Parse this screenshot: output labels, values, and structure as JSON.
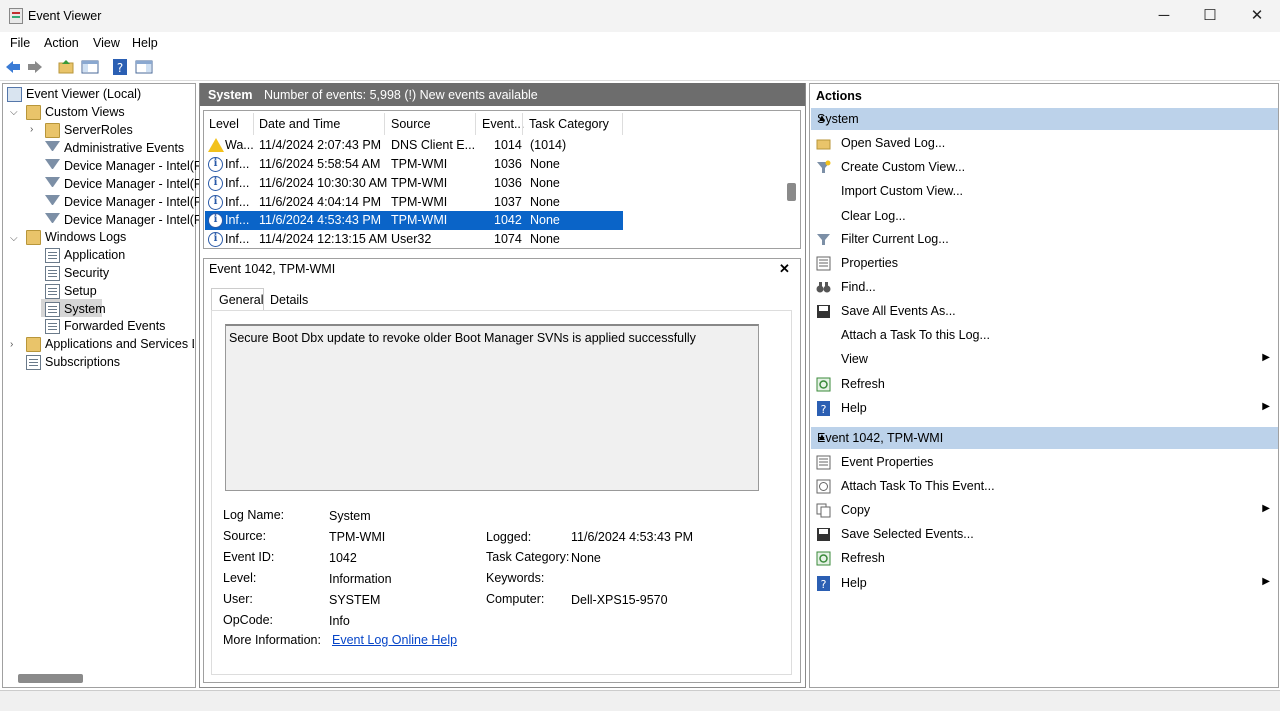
{
  "window": {
    "title": "Event Viewer",
    "minimize": "─",
    "maximize": "☐",
    "close": "✕"
  },
  "menu": [
    "File",
    "Action",
    "View",
    "Help"
  ],
  "tree": {
    "root": "Event Viewer (Local)",
    "custom_views": "Custom Views",
    "server_roles": "ServerRoles",
    "admin_events": "Administrative Events",
    "dm1": "Device Manager - Intel(R)",
    "dm2": "Device Manager - Intel(R)",
    "dm3": "Device Manager - Intel(R)",
    "dm4": "Device Manager - Intel(R)",
    "windows_logs": "Windows Logs",
    "application": "Application",
    "security": "Security",
    "setup": "Setup",
    "system": "System",
    "forwarded": "Forwarded Events",
    "apps_services": "Applications and Services Log",
    "subscriptions": "Subscriptions"
  },
  "log_header": {
    "name": "System",
    "summary": "Number of events: 5,998 (!) New events available"
  },
  "columns": {
    "level": "Level",
    "datetime": "Date and Time",
    "source": "Source",
    "event": "Event...",
    "category": "Task Category"
  },
  "rows": [
    {
      "level": "Wa...",
      "datetime": "11/4/2024 2:07:43 PM",
      "source": "DNS Client E...",
      "event": "1014",
      "category": "(1014)"
    },
    {
      "level": "Inf...",
      "datetime": "11/6/2024 5:58:54 AM",
      "source": "TPM-WMI",
      "event": "1036",
      "category": "None"
    },
    {
      "level": "Inf...",
      "datetime": "11/6/2024 10:30:30 AM",
      "source": "TPM-WMI",
      "event": "1036",
      "category": "None"
    },
    {
      "level": "Inf...",
      "datetime": "11/6/2024 4:04:14 PM",
      "source": "TPM-WMI",
      "event": "1037",
      "category": "None"
    },
    {
      "level": "Inf...",
      "datetime": "11/6/2024 4:53:43 PM",
      "source": "TPM-WMI",
      "event": "1042",
      "category": "None"
    },
    {
      "level": "Inf...",
      "datetime": "11/4/2024 12:13:15 AM",
      "source": "User32",
      "event": "1074",
      "category": "None"
    }
  ],
  "detail": {
    "title": "Event 1042, TPM-WMI",
    "close": "✕",
    "tab_general": "General",
    "tab_details": "Details",
    "message": "Secure Boot Dbx update to revoke older Boot Manager SVNs is applied successfully",
    "labels": {
      "log_name": "Log Name:",
      "source": "Source:",
      "event_id": "Event ID:",
      "level": "Level:",
      "user": "User:",
      "opcode": "OpCode:",
      "more_info": "More Information:",
      "logged": "Logged:",
      "task_category": "Task Category:",
      "keywords": "Keywords:",
      "computer": "Computer:"
    },
    "values": {
      "log_name": "System",
      "source": "TPM-WMI",
      "event_id": "1042",
      "level": "Information",
      "user": "SYSTEM",
      "opcode": "Info",
      "more_info": "Event Log Online Help",
      "logged": "11/6/2024 4:53:43 PM",
      "task_category": "None",
      "keywords": "",
      "computer": "Dell-XPS15-9570"
    }
  },
  "actions": {
    "title": "Actions",
    "section1": "System",
    "section1_items": [
      "Open Saved Log...",
      "Create Custom View...",
      "Import Custom View...",
      "Clear Log...",
      "Filter Current Log...",
      "Properties",
      "Find...",
      "Save All Events As...",
      "Attach a Task To this Log...",
      "View",
      "Refresh",
      "Help"
    ],
    "section2": "Event 1042, TPM-WMI",
    "section2_items": [
      "Event Properties",
      "Attach Task To This Event...",
      "Copy",
      "Save Selected Events...",
      "Refresh",
      "Help"
    ]
  }
}
